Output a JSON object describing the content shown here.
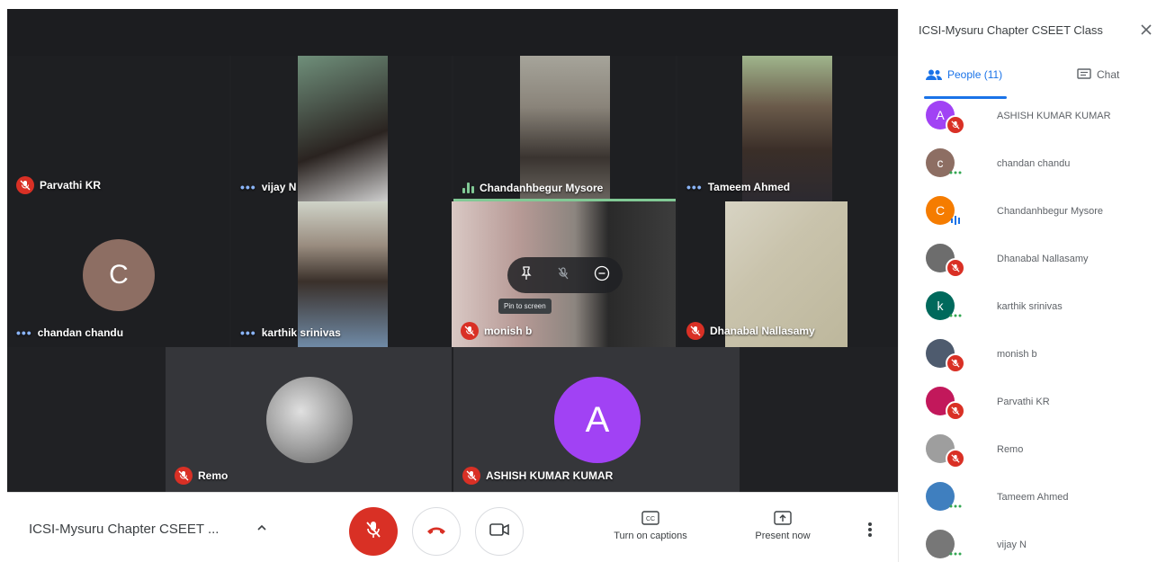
{
  "meeting": {
    "title": "ICSI-Mysuru Chapter CSEET ...",
    "panel_title": "ICSI-Mysuru Chapter CSEET Class"
  },
  "tiles": {
    "parvathi": "Parvathi KR",
    "vijay": "vijay N",
    "chandanh": "Chandanhbegur Mysore",
    "tameem": "Tameem Ahmed",
    "chandan": "chandan chandu",
    "karthik": "karthik srinivas",
    "monish": "monish b",
    "dhanabal": "Dhanabal Nallasamy",
    "remo": "Remo",
    "ashish": "ASHISH KUMAR KUMAR"
  },
  "avatars": {
    "chandan_initial": "C",
    "ashish_initial": "A"
  },
  "hover": {
    "tooltip": "Pin to screen"
  },
  "toolbar": {
    "captions": "Turn on captions",
    "present": "Present now"
  },
  "tabs": {
    "people": "People (11)",
    "chat": "Chat"
  },
  "people": [
    {
      "name": "ASHISH KUMAR KUMAR",
      "initial": "A",
      "color": "#a142f4",
      "status": "muted"
    },
    {
      "name": "chandan chandu",
      "initial": "c",
      "color": "#8d6e63",
      "status": "dots"
    },
    {
      "name": "Chandanhbegur Mysore",
      "initial": "C",
      "color": "#f57c00",
      "status": "speaking"
    },
    {
      "name": "Dhanabal Nallasamy",
      "initial": "",
      "color": "#6d6d6d",
      "status": "muted"
    },
    {
      "name": "karthik srinivas",
      "initial": "k",
      "color": "#00695c",
      "status": "dots"
    },
    {
      "name": "monish b",
      "initial": "",
      "color": "#4e5b6e",
      "status": "muted"
    },
    {
      "name": "Parvathi KR",
      "initial": "",
      "color": "#c2185b",
      "status": "muted"
    },
    {
      "name": "Remo",
      "initial": "",
      "color": "#9e9e9e",
      "status": "muted"
    },
    {
      "name": "Tameem Ahmed",
      "initial": "",
      "color": "#3f7fbf",
      "status": "dots"
    },
    {
      "name": "vijay N",
      "initial": "",
      "color": "#777777",
      "status": "dots"
    }
  ],
  "colors": {
    "accent": "#1a73e8",
    "muted_red": "#d93025",
    "speaking_green": "#81c995"
  }
}
